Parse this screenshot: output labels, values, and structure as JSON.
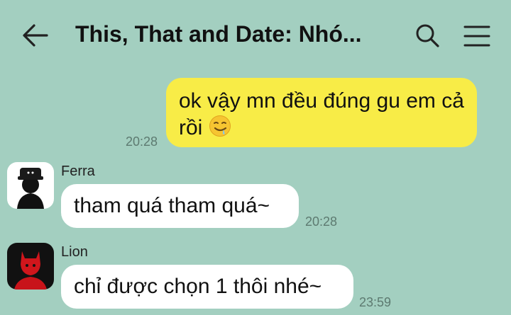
{
  "header": {
    "title": "This, That and Date: Nhó...",
    "back_icon": "arrow-left-icon",
    "search_icon": "search-icon",
    "menu_icon": "hamburger-menu-icon"
  },
  "messages": [
    {
      "direction": "outgoing",
      "text_line1": "ok vậy mn đều đúng gu em cả",
      "text_line2": "rồi",
      "emoji": "drooling-face-emoji",
      "time": "20:28"
    },
    {
      "direction": "incoming",
      "sender": "Ferra",
      "text": "tham quá tham quá~",
      "time": "20:28",
      "avatar": "ferra-avatar"
    },
    {
      "direction": "incoming",
      "sender": "Lion",
      "text": "chỉ được chọn 1 thôi nhé~",
      "time": "23:59",
      "avatar": "lion-avatar"
    }
  ],
  "colors": {
    "background": "#a3cfc0",
    "outgoing_bubble": "#f8ec47",
    "incoming_bubble": "#ffffff"
  }
}
